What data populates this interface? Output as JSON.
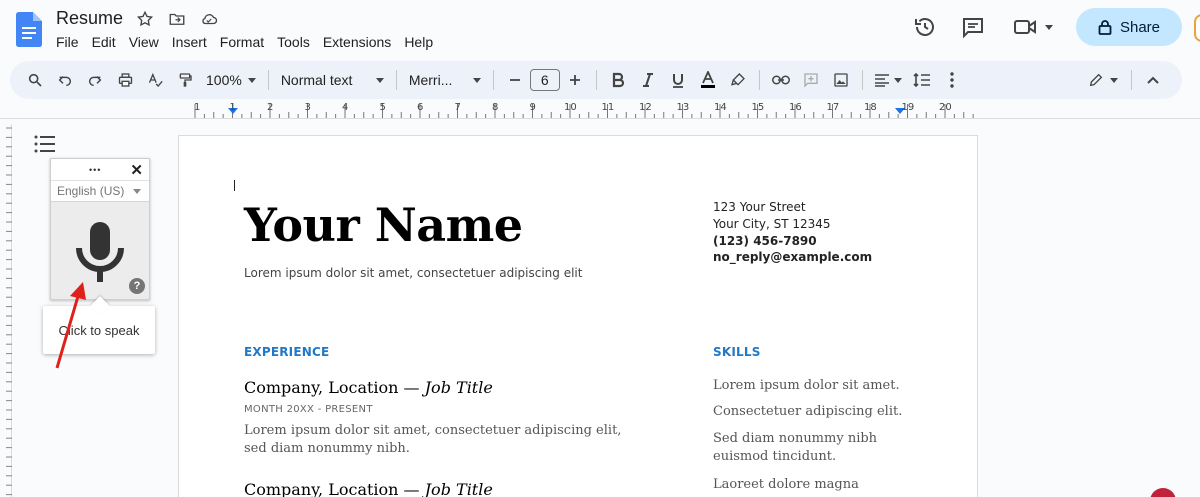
{
  "doc": {
    "title": "Resume"
  },
  "menu": [
    "File",
    "Edit",
    "View",
    "Insert",
    "Format",
    "Tools",
    "Extensions",
    "Help"
  ],
  "header": {
    "share_label": "Share"
  },
  "toolbar": {
    "zoom": "100%",
    "style": "Normal text",
    "font": "Merri...",
    "font_size": "6"
  },
  "ruler": {
    "numbers": [
      "1",
      "1",
      "2",
      "3",
      "4",
      "5",
      "6",
      "7",
      "8",
      "9",
      "10",
      "11",
      "12",
      "13",
      "14",
      "15",
      "16",
      "17",
      "18",
      "19",
      "20"
    ]
  },
  "voice": {
    "menu_dots": "•••",
    "close": "✕",
    "language": "English (US)",
    "help": "?",
    "tooltip": "Click to speak"
  },
  "resume": {
    "name": "Your Name",
    "tagline": "Lorem ipsum dolor sit amet, consectetuer adipiscing elit",
    "address1": "123 Your Street",
    "address2": "Your City, ST 12345",
    "phone": "(123) 456-7890",
    "email": "no_reply@example.com",
    "experience_heading": "EXPERIENCE",
    "skills_heading": "SKILLS",
    "jobs": [
      {
        "company": "Company,",
        "location": " Location — ",
        "title": "Job Title",
        "dates": "MONTH 20XX - PRESENT",
        "desc": "Lorem ipsum dolor sit amet, consectetuer adipiscing elit, sed diam nonummy nibh."
      },
      {
        "company": "Company,",
        "location": " Location — ",
        "title": "Job Title"
      }
    ],
    "skills": [
      "Lorem ipsum dolor sit amet.",
      "Consectetuer adipiscing elit.",
      "Sed diam nonummy nibh euismod tincidunt.",
      "Laoreet dolore magna"
    ]
  },
  "colors": {
    "accent": "#2079c7",
    "share_bg": "#c2e7ff",
    "toolbar_bg": "#edf2fa",
    "annotation_arrow": "#e0201a"
  },
  "icons": [
    "docs-logo",
    "star-icon",
    "move-to-folder-icon",
    "cloud-saved-icon",
    "history-icon",
    "comment-icon",
    "meet-icon",
    "lock-icon",
    "search-icon",
    "undo-icon",
    "redo-icon",
    "print-icon",
    "spellcheck-icon",
    "paint-format-icon",
    "bold-icon",
    "italic-icon",
    "underline-icon",
    "text-color-icon",
    "highlight-icon",
    "link-icon",
    "add-comment-icon",
    "image-icon",
    "align-icon",
    "line-spacing-icon",
    "more-icon",
    "edit-mode-icon",
    "collapse-icon",
    "outline-icon",
    "microphone-icon"
  ]
}
